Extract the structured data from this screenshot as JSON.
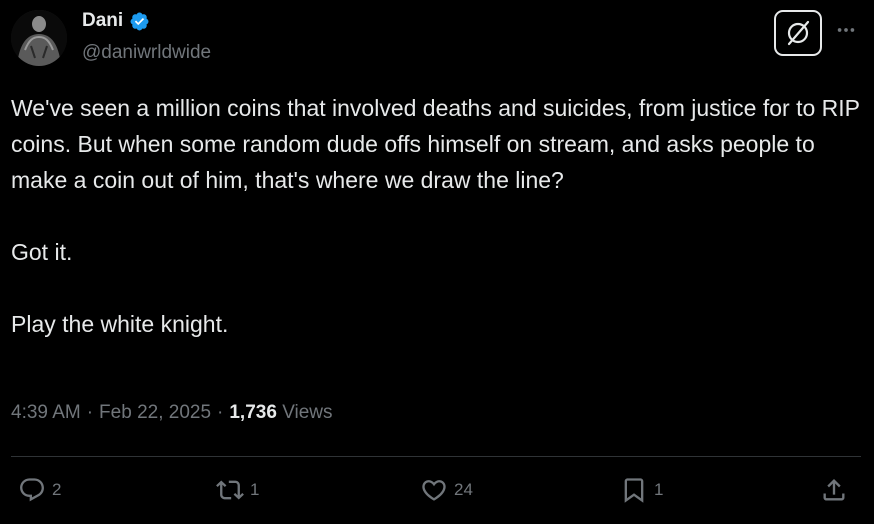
{
  "author": {
    "display_name": "Dani",
    "handle": "@daniwrldwide",
    "verified": true
  },
  "tweet": {
    "paragraphs": [
      "We've seen a million coins that involved deaths and suicides, from justice for to RIP coins. But when some random dude offs himself on stream, and asks people to make a coin out of him, that's where we draw the line?",
      "Got it.",
      "Play the white knight."
    ]
  },
  "meta": {
    "time": "4:39 AM",
    "separator": "·",
    "date": "Feb 22, 2025",
    "views_count": "1,736",
    "views_label": "Views"
  },
  "actions": {
    "replies": "2",
    "reposts": "1",
    "likes": "24",
    "bookmarks": "1"
  },
  "icons": {
    "more": "more-dots-icon",
    "grok": "grok-icon",
    "reply": "reply-icon",
    "repost": "repost-icon",
    "like": "heart-icon",
    "bookmark": "bookmark-icon",
    "share": "share-icon"
  },
  "colors": {
    "background": "#000000",
    "text": "#e7e9ea",
    "secondary": "#71767b",
    "verified": "#1d9bf0",
    "divider": "#2f3336"
  }
}
